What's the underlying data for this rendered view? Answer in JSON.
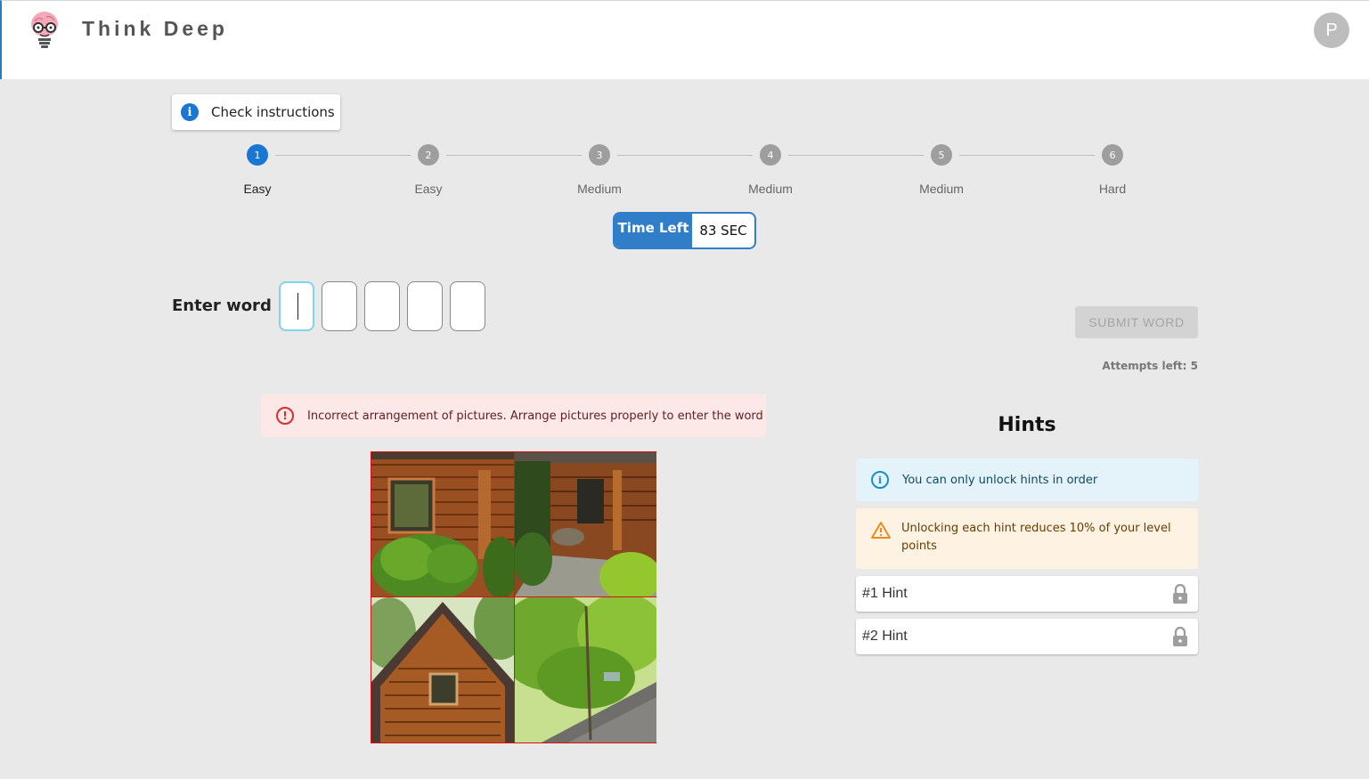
{
  "app": {
    "title": "Think Deep",
    "user_initial": "P"
  },
  "instructions_button": {
    "label": "Check instructions",
    "icon": "info-icon"
  },
  "levels": [
    {
      "number": "1",
      "label": "Easy",
      "active": true
    },
    {
      "number": "2",
      "label": "Easy",
      "active": false
    },
    {
      "number": "3",
      "label": "Medium",
      "active": false
    },
    {
      "number": "4",
      "label": "Medium",
      "active": false
    },
    {
      "number": "5",
      "label": "Medium",
      "active": false
    },
    {
      "number": "6",
      "label": "Hard",
      "active": false
    }
  ],
  "timer": {
    "label": "Time Left",
    "value": "83 SEC"
  },
  "word_entry": {
    "label": "Enter word",
    "letters": [
      "",
      "",
      "",
      "",
      ""
    ]
  },
  "submit_button": {
    "label": "SUBMIT WORD",
    "disabled": true
  },
  "attempts": {
    "text": "Attempts left: 5"
  },
  "error_alert": {
    "text": "Incorrect arrangement of pictures. Arrange pictures properly to enter the word"
  },
  "puzzle": {
    "tiles": [
      "log-cabin-porch-tile",
      "cabin-garden-path-tile",
      "cabin-gable-roof-tile",
      "tree-over-roof-tile"
    ]
  },
  "hints": {
    "title": "Hints",
    "info": "You can only unlock hints in order",
    "warning": "Unlocking each hint reduces 10% of your level points",
    "items": [
      {
        "label": "#1 Hint",
        "locked": true
      },
      {
        "label": "#2 Hint",
        "locked": true
      }
    ]
  },
  "colors": {
    "primary": "#1976d2",
    "background": "#e9e9e9",
    "error": "#d32f2f"
  }
}
